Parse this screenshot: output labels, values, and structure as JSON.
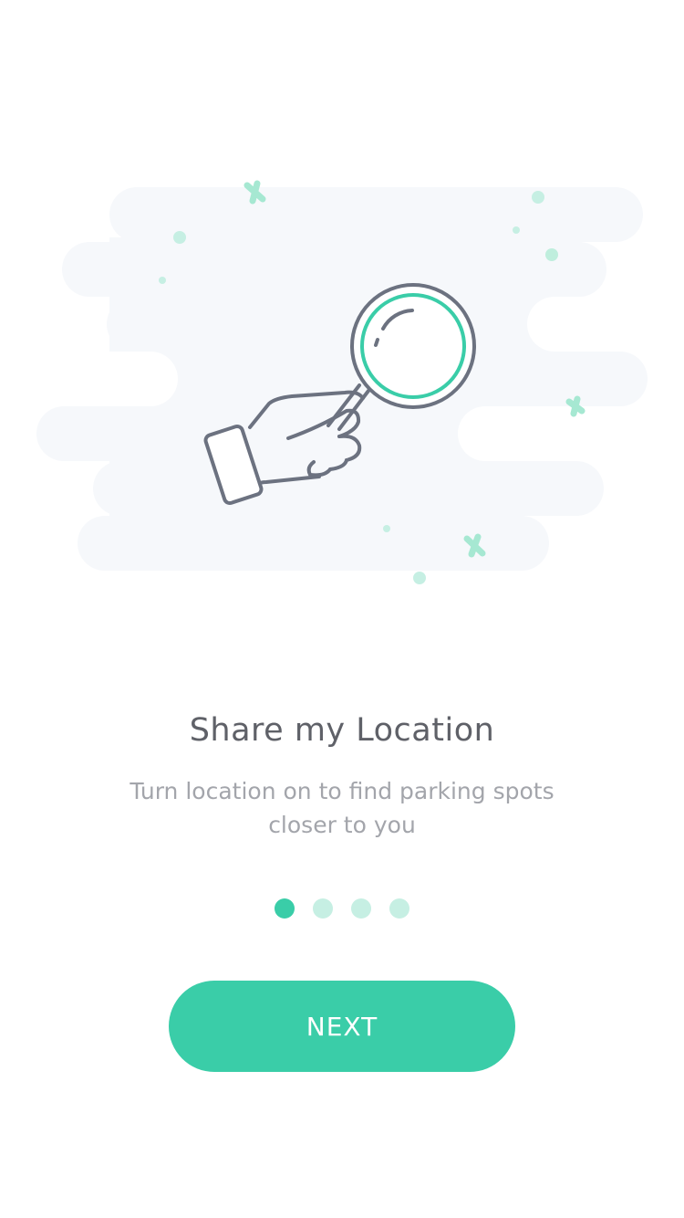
{
  "onboarding": {
    "title": "Share my Location",
    "subtitle": "Turn location on to find parking spots closer to you",
    "page_indicator": {
      "total": 4,
      "current": 1
    },
    "next_label": "NEXT"
  },
  "illustration": {
    "icon": "hand-holding-magnifying-glass-icon"
  },
  "colors": {
    "accent": "#3acda8",
    "accent_light": "#c6efe3",
    "cloud": "#f6f8fb",
    "outline": "#6c7280",
    "title": "#5f6168",
    "subtitle": "#a3a5ab"
  }
}
